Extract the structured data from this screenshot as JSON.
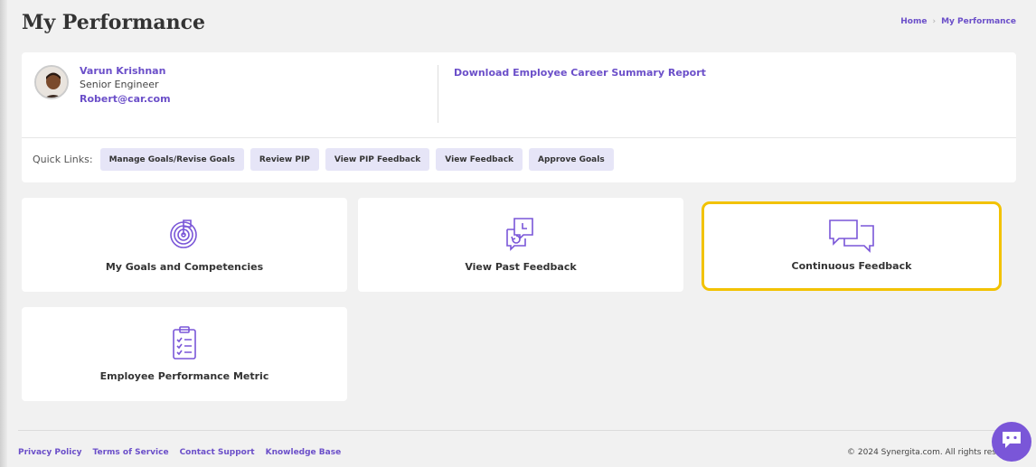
{
  "page": {
    "title": "My Performance"
  },
  "breadcrumb": {
    "home": "Home",
    "current": "My Performance"
  },
  "profile": {
    "name": "Varun Krishnan",
    "role": "Senior Engineer",
    "email": "Robert@car.com",
    "download_link": "Download Employee Career Summary Report"
  },
  "quick_links": {
    "label": "Quick Links:",
    "items": [
      {
        "label": "Manage Goals/Revise Goals"
      },
      {
        "label": "Review PIP"
      },
      {
        "label": "View PIP Feedback"
      },
      {
        "label": "View Feedback"
      },
      {
        "label": "Approve Goals"
      }
    ]
  },
  "tiles": [
    {
      "label": "My Goals and Competencies",
      "icon": "target-icon"
    },
    {
      "label": "View Past Feedback",
      "icon": "feedback-history-icon"
    },
    {
      "label": "Continuous Feedback",
      "icon": "chat-bubbles-icon",
      "highlighted": true
    },
    {
      "label": "Employee Performance Metric",
      "icon": "clipboard-checklist-icon"
    }
  ],
  "footer": {
    "links": [
      "Privacy Policy",
      "Terms of Service",
      "Contact Support",
      "Knowledge Base"
    ],
    "copyright": "© 2024 Synergita.com. All rights res"
  },
  "colors": {
    "accent": "#6b4fc9",
    "highlight": "#f2c200",
    "chip_bg": "#e6e5f7",
    "fab": "#7a56d8"
  }
}
